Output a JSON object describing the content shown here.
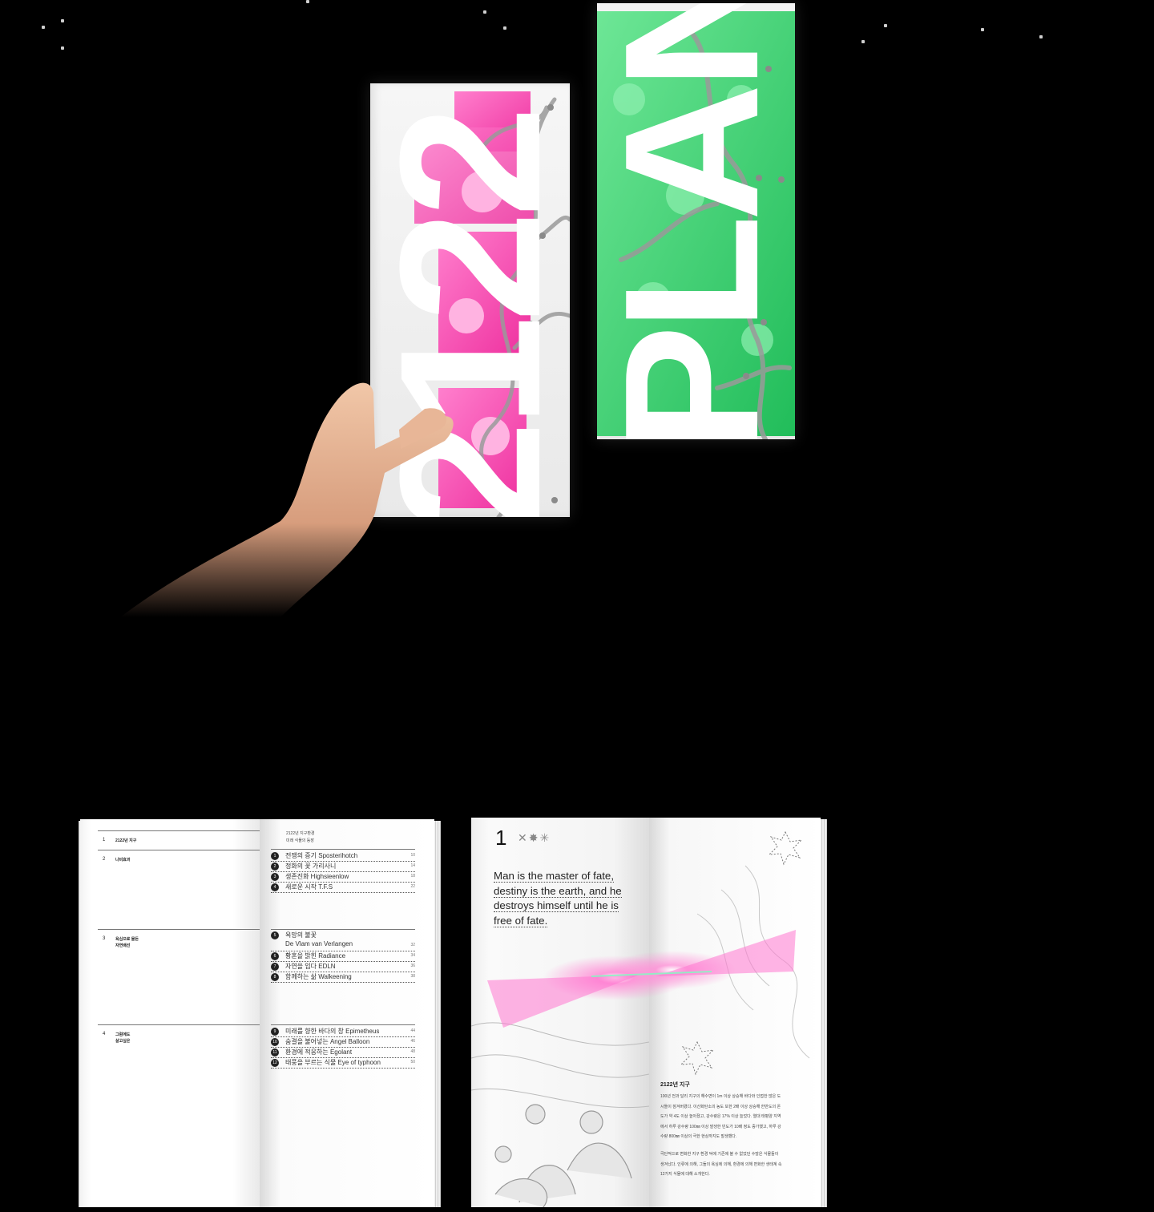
{
  "colors": {
    "background": "#000000",
    "pink_accent": "#ee3fa8",
    "green_accent": "#1ed760"
  },
  "covers": {
    "pink_word": "2122",
    "green_word": "PLANT"
  },
  "toc_spread": {
    "left_sections": [
      {
        "number": "1",
        "title": "2122년 지구"
      },
      {
        "number": "2",
        "title": "나비효과"
      },
      {
        "number": "3",
        "title": "욕심으로 물든\n자연배선"
      },
      {
        "number": "4",
        "title": "그럼에도\n살고싶은"
      }
    ],
    "header": "2122년 지구환경\n미래 식물의 등장",
    "groups": [
      [
        {
          "n": "1",
          "title": "전쟁의 증기 Sposterihotch",
          "page": "10"
        },
        {
          "n": "2",
          "title": "정화의 꽃 가리사니",
          "page": "14"
        },
        {
          "n": "3",
          "title": "생존진화 Highsieenlow",
          "page": "18"
        },
        {
          "n": "4",
          "title": "새로운 시작 T.F.S",
          "page": "22"
        }
      ],
      [
        {
          "n": "5",
          "title": "욕망의 불꽃",
          "title2": "De Vlam van Verlangen",
          "page": "32"
        },
        {
          "n": "6",
          "title": "황혼을 밝힌 Radiance",
          "page": "34"
        },
        {
          "n": "7",
          "title": "자연을 입다 EDLN",
          "page": "36"
        },
        {
          "n": "8",
          "title": "함께하는 삶 Walkeening",
          "page": "38"
        }
      ],
      [
        {
          "n": "9",
          "title": "미래를 향한 바다의 창 Epimetheus",
          "page": "44"
        },
        {
          "n": "10",
          "title": "숨결을 불어넣는 Angel Balloon",
          "page": "46"
        },
        {
          "n": "11",
          "title": "환경에 적응하는 Egolant",
          "page": "48"
        },
        {
          "n": "12",
          "title": "태풍을 부르는 식물 Eye of typhoon",
          "page": "50"
        }
      ]
    ]
  },
  "chapter_spread": {
    "number": "1",
    "marks": "✕✸✳",
    "quote_lines": [
      "Man is the master of fate,",
      "destiny is the earth, and he",
      "destroys himself until he is",
      "free of fate."
    ],
    "article_title": "2122년 지구",
    "article_lines": [
      "100년 전과 달리 지구의 해수면이 1m 이상 상승해 바다와 인접한 많은 도",
      "시들이 잠겨버렸다. 이산화탄소의 농도 또한 2배 이상 상승해 한반도의 온",
      "도가 약 4도 이상 높아졌고, 강수량은 17% 이상 늘었다. 열대 태평양 지역",
      "에서 하루 강수량 100㎜ 이상 발생한 빈도가 10배 정도 증가했고, 하루 강",
      "수량 800㎜ 이상의 극한 현상까지도 발생했다."
    ],
    "article_lines_2": [
      "극단적으로 변화한 지구 환경 덕에 기존에 볼 수 없었던 수많은 식물들이",
      "생겨났다. 인류에 의해, 그들의 욕심에 의해, 환경에 의해 변화한 생태계 속",
      "12가지 식물에 대해 소개한다."
    ]
  }
}
